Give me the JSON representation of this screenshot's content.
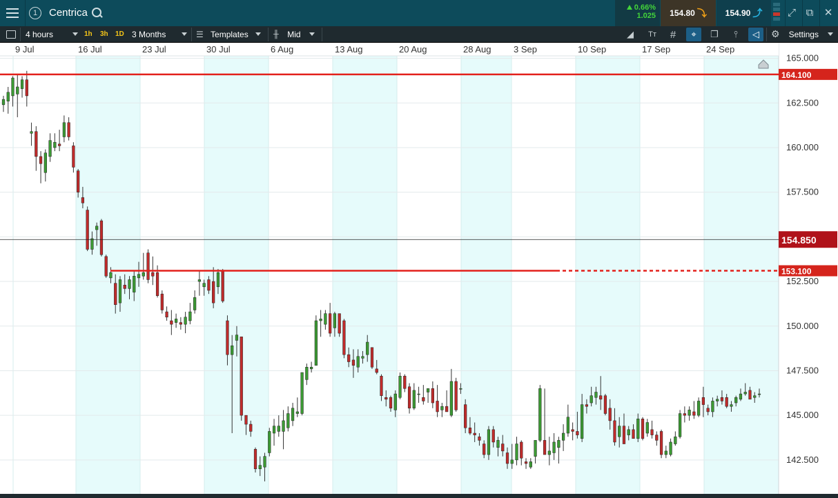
{
  "title_bar": {
    "instrument": "Centrica",
    "panel_number": "1",
    "change_percent": "0.66%",
    "change_abs": "1.025",
    "sell_price": "154.80",
    "buy_price": "154.90",
    "up_color": "#43d43a",
    "sell_color": "#f0a017",
    "buy_color": "#28b6e4"
  },
  "toolbar": {
    "interval": "4 hours",
    "quick_intervals": [
      "1h",
      "3h",
      "1D"
    ],
    "range": "3 Months",
    "templates_label": "Templates",
    "price_type": "Mid",
    "settings_label": "Settings",
    "icons": [
      "drawing-tools-icon",
      "text-tool-icon",
      "grid-icon",
      "crosshair-icon",
      "layers-icon",
      "indicators-icon",
      "price-tag-icon",
      "gear-icon"
    ]
  },
  "chart_data": {
    "type": "candlestick",
    "x_tick_labels": [
      "9 Jul",
      "16 Jul",
      "23 Jul",
      "30 Jul",
      "6 Aug",
      "13 Aug",
      "20 Aug",
      "28 Aug",
      "3 Sep",
      "10 Sep",
      "17 Sep",
      "24 Sep"
    ],
    "y_tick_labels": [
      "165.000",
      "162.500",
      "160.000",
      "157.500",
      "155.000",
      "152.500",
      "150.000",
      "147.500",
      "145.000",
      "142.500"
    ],
    "ylim": [
      140.6,
      165.1
    ],
    "current_price": "154.850",
    "horizontal_lines": [
      {
        "label": "164.100",
        "value": 164.1,
        "style": "solid"
      },
      {
        "label": "153.100",
        "value": 153.1,
        "style": "solid-then-dashed"
      }
    ],
    "colors": {
      "up": "#3c9a34",
      "down": "#c02b2b",
      "line": "#e3201b",
      "weekend_shade": "#e6fbfb"
    },
    "candles": [
      {
        "o": 162.4,
        "h": 162.9,
        "l": 162.0,
        "c": 162.7
      },
      {
        "o": 162.6,
        "h": 163.4,
        "l": 161.9,
        "c": 163.1
      },
      {
        "o": 162.9,
        "h": 164.0,
        "l": 162.3,
        "c": 163.9
      },
      {
        "o": 163.0,
        "h": 164.1,
        "l": 161.7,
        "c": 163.4
      },
      {
        "o": 163.3,
        "h": 164.0,
        "l": 162.8,
        "c": 163.8
      },
      {
        "o": 163.8,
        "h": 164.3,
        "l": 162.3,
        "c": 162.9
      },
      {
        "o": 160.8,
        "h": 161.4,
        "l": 160.1,
        "c": 160.9
      },
      {
        "o": 160.9,
        "h": 161.2,
        "l": 158.7,
        "c": 159.5
      },
      {
        "o": 159.5,
        "h": 159.8,
        "l": 158.0,
        "c": 159.1
      },
      {
        "o": 158.6,
        "h": 159.9,
        "l": 158.1,
        "c": 159.7
      },
      {
        "o": 159.5,
        "h": 160.8,
        "l": 159.2,
        "c": 160.4
      },
      {
        "o": 160.0,
        "h": 160.8,
        "l": 159.8,
        "c": 160.3
      },
      {
        "o": 160.2,
        "h": 161.0,
        "l": 159.8,
        "c": 160.1
      },
      {
        "o": 160.6,
        "h": 161.8,
        "l": 160.3,
        "c": 161.4
      },
      {
        "o": 161.4,
        "h": 161.7,
        "l": 160.4,
        "c": 160.6
      },
      {
        "o": 160.1,
        "h": 160.3,
        "l": 158.6,
        "c": 158.9
      },
      {
        "o": 158.7,
        "h": 158.8,
        "l": 157.2,
        "c": 157.5
      },
      {
        "o": 157.2,
        "h": 157.8,
        "l": 156.6,
        "c": 156.9
      },
      {
        "o": 156.5,
        "h": 156.7,
        "l": 154.2,
        "c": 154.3
      },
      {
        "o": 154.3,
        "h": 155.3,
        "l": 154.0,
        "c": 154.9
      },
      {
        "o": 155.4,
        "h": 155.8,
        "l": 154.5,
        "c": 155.6
      },
      {
        "o": 155.9,
        "h": 156.0,
        "l": 153.9,
        "c": 154.0
      },
      {
        "o": 153.9,
        "h": 154.0,
        "l": 152.7,
        "c": 152.8
      },
      {
        "o": 152.7,
        "h": 153.3,
        "l": 152.4,
        "c": 153.0
      },
      {
        "o": 152.4,
        "h": 152.9,
        "l": 150.7,
        "c": 151.2
      },
      {
        "o": 151.3,
        "h": 152.8,
        "l": 150.8,
        "c": 152.6
      },
      {
        "o": 152.3,
        "h": 152.9,
        "l": 151.8,
        "c": 152.1
      },
      {
        "o": 152.1,
        "h": 152.8,
        "l": 151.5,
        "c": 152.6
      },
      {
        "o": 151.9,
        "h": 153.1,
        "l": 151.4,
        "c": 152.8
      },
      {
        "o": 152.7,
        "h": 153.6,
        "l": 152.2,
        "c": 152.9
      },
      {
        "o": 152.8,
        "h": 154.1,
        "l": 152.6,
        "c": 153.0
      },
      {
        "o": 154.1,
        "h": 154.3,
        "l": 152.4,
        "c": 152.6
      },
      {
        "o": 153.0,
        "h": 153.9,
        "l": 152.3,
        "c": 152.8
      },
      {
        "o": 153.0,
        "h": 153.4,
        "l": 151.6,
        "c": 151.7
      },
      {
        "o": 151.8,
        "h": 152.0,
        "l": 150.7,
        "c": 150.9
      },
      {
        "o": 150.8,
        "h": 151.1,
        "l": 150.3,
        "c": 150.5
      },
      {
        "o": 150.3,
        "h": 150.9,
        "l": 149.5,
        "c": 150.1
      },
      {
        "o": 150.2,
        "h": 150.7,
        "l": 149.9,
        "c": 150.4
      },
      {
        "o": 150.2,
        "h": 150.5,
        "l": 149.8,
        "c": 150.1
      },
      {
        "o": 150.1,
        "h": 150.8,
        "l": 149.6,
        "c": 150.5
      },
      {
        "o": 150.3,
        "h": 151.3,
        "l": 150.1,
        "c": 150.8
      },
      {
        "o": 150.9,
        "h": 152.0,
        "l": 150.7,
        "c": 151.6
      },
      {
        "o": 152.5,
        "h": 153.1,
        "l": 151.7,
        "c": 152.6
      },
      {
        "o": 152.2,
        "h": 152.6,
        "l": 151.7,
        "c": 152.4
      },
      {
        "o": 152.6,
        "h": 152.8,
        "l": 151.8,
        "c": 152.0
      },
      {
        "o": 152.5,
        "h": 153.3,
        "l": 151.0,
        "c": 151.3
      },
      {
        "o": 152.2,
        "h": 153.2,
        "l": 151.8,
        "c": 153.0
      },
      {
        "o": 153.1,
        "h": 153.2,
        "l": 151.3,
        "c": 151.4
      },
      {
        "o": 150.3,
        "h": 150.6,
        "l": 147.8,
        "c": 148.4
      },
      {
        "o": 148.4,
        "h": 149.5,
        "l": 144.0,
        "c": 148.9
      },
      {
        "o": 149.2,
        "h": 150.0,
        "l": 148.3,
        "c": 149.5
      },
      {
        "o": 149.4,
        "h": 149.4,
        "l": 144.7,
        "c": 145.0
      },
      {
        "o": 145.0,
        "h": 145.0,
        "l": 143.9,
        "c": 144.5
      },
      {
        "o": 144.5,
        "h": 144.7,
        "l": 143.8,
        "c": 144.1
      },
      {
        "o": 143.1,
        "h": 143.2,
        "l": 141.8,
        "c": 142.0
      },
      {
        "o": 142.0,
        "h": 142.7,
        "l": 141.6,
        "c": 142.2
      },
      {
        "o": 142.1,
        "h": 142.9,
        "l": 141.3,
        "c": 142.7
      },
      {
        "o": 142.9,
        "h": 144.3,
        "l": 142.7,
        "c": 144.1
      },
      {
        "o": 144.0,
        "h": 144.8,
        "l": 143.3,
        "c": 144.4
      },
      {
        "o": 144.1,
        "h": 145.0,
        "l": 143.8,
        "c": 144.4
      },
      {
        "o": 144.1,
        "h": 145.3,
        "l": 143.1,
        "c": 144.7
      },
      {
        "o": 144.3,
        "h": 145.5,
        "l": 144.1,
        "c": 145.1
      },
      {
        "o": 144.7,
        "h": 145.7,
        "l": 144.4,
        "c": 145.4
      },
      {
        "o": 145.1,
        "h": 146.0,
        "l": 144.9,
        "c": 145.2
      },
      {
        "o": 145.1,
        "h": 147.4,
        "l": 145.0,
        "c": 147.4
      },
      {
        "o": 147.0,
        "h": 147.9,
        "l": 146.7,
        "c": 147.7
      },
      {
        "o": 147.6,
        "h": 148.0,
        "l": 147.4,
        "c": 147.7
      },
      {
        "o": 147.8,
        "h": 150.6,
        "l": 147.8,
        "c": 150.3
      },
      {
        "o": 150.3,
        "h": 150.9,
        "l": 149.4,
        "c": 150.4
      },
      {
        "o": 150.1,
        "h": 150.9,
        "l": 149.8,
        "c": 150.7
      },
      {
        "o": 150.7,
        "h": 151.3,
        "l": 149.4,
        "c": 149.6
      },
      {
        "o": 149.9,
        "h": 150.8,
        "l": 149.4,
        "c": 150.7
      },
      {
        "o": 150.7,
        "h": 150.7,
        "l": 149.4,
        "c": 149.6
      },
      {
        "o": 150.3,
        "h": 150.4,
        "l": 148.2,
        "c": 148.4
      },
      {
        "o": 148.4,
        "h": 148.8,
        "l": 147.7,
        "c": 148.0
      },
      {
        "o": 148.1,
        "h": 148.7,
        "l": 147.1,
        "c": 147.8
      },
      {
        "o": 147.7,
        "h": 148.7,
        "l": 147.4,
        "c": 148.3
      },
      {
        "o": 148.2,
        "h": 148.6,
        "l": 147.9,
        "c": 148.3
      },
      {
        "o": 148.4,
        "h": 149.5,
        "l": 148.0,
        "c": 149.1
      },
      {
        "o": 148.8,
        "h": 148.8,
        "l": 147.6,
        "c": 147.7
      },
      {
        "o": 147.6,
        "h": 148.1,
        "l": 147.3,
        "c": 147.4
      },
      {
        "o": 147.2,
        "h": 147.3,
        "l": 145.8,
        "c": 146.1
      },
      {
        "o": 146.0,
        "h": 146.4,
        "l": 145.5,
        "c": 145.9
      },
      {
        "o": 146.0,
        "h": 146.1,
        "l": 145.2,
        "c": 145.4
      },
      {
        "o": 145.3,
        "h": 146.4,
        "l": 144.9,
        "c": 146.2
      },
      {
        "o": 146.0,
        "h": 147.4,
        "l": 145.9,
        "c": 147.2
      },
      {
        "o": 147.2,
        "h": 147.3,
        "l": 146.3,
        "c": 146.5
      },
      {
        "o": 146.6,
        "h": 146.8,
        "l": 145.1,
        "c": 145.4
      },
      {
        "o": 145.4,
        "h": 146.8,
        "l": 145.3,
        "c": 146.4
      },
      {
        "o": 146.2,
        "h": 146.6,
        "l": 145.7,
        "c": 146.2
      },
      {
        "o": 146.0,
        "h": 146.7,
        "l": 145.6,
        "c": 145.8
      },
      {
        "o": 146.3,
        "h": 146.5,
        "l": 145.7,
        "c": 146.5
      },
      {
        "o": 146.5,
        "h": 146.9,
        "l": 145.4,
        "c": 145.7
      },
      {
        "o": 145.8,
        "h": 146.7,
        "l": 144.9,
        "c": 145.2
      },
      {
        "o": 145.3,
        "h": 145.7,
        "l": 144.9,
        "c": 145.5
      },
      {
        "o": 145.5,
        "h": 146.4,
        "l": 145.4,
        "c": 145.2
      },
      {
        "o": 145.0,
        "h": 147.6,
        "l": 144.9,
        "c": 146.9
      },
      {
        "o": 146.9,
        "h": 147.1,
        "l": 145.2,
        "c": 145.3
      },
      {
        "o": 146.5,
        "h": 146.8,
        "l": 146.2,
        "c": 146.5
      },
      {
        "o": 145.6,
        "h": 145.9,
        "l": 144.0,
        "c": 144.3
      },
      {
        "o": 144.3,
        "h": 144.9,
        "l": 143.9,
        "c": 144.0
      },
      {
        "o": 144.0,
        "h": 144.6,
        "l": 143.5,
        "c": 143.9
      },
      {
        "o": 143.8,
        "h": 144.0,
        "l": 143.3,
        "c": 143.6
      },
      {
        "o": 143.4,
        "h": 143.6,
        "l": 142.6,
        "c": 142.8
      },
      {
        "o": 142.8,
        "h": 144.4,
        "l": 142.5,
        "c": 144.2
      },
      {
        "o": 144.2,
        "h": 144.4,
        "l": 143.2,
        "c": 143.5
      },
      {
        "o": 143.2,
        "h": 143.8,
        "l": 142.7,
        "c": 143.6
      },
      {
        "o": 143.4,
        "h": 143.9,
        "l": 142.7,
        "c": 143.0
      },
      {
        "o": 142.9,
        "h": 143.2,
        "l": 142.0,
        "c": 142.3
      },
      {
        "o": 142.3,
        "h": 143.4,
        "l": 142.0,
        "c": 142.5
      },
      {
        "o": 142.5,
        "h": 143.8,
        "l": 142.2,
        "c": 143.4
      },
      {
        "o": 143.5,
        "h": 143.6,
        "l": 142.2,
        "c": 142.6
      },
      {
        "o": 142.4,
        "h": 142.6,
        "l": 142.0,
        "c": 142.3
      },
      {
        "o": 142.1,
        "h": 142.6,
        "l": 142.0,
        "c": 142.4
      },
      {
        "o": 142.7,
        "h": 143.6,
        "l": 142.3,
        "c": 143.6
      },
      {
        "o": 143.6,
        "h": 146.7,
        "l": 143.5,
        "c": 146.5
      },
      {
        "o": 143.6,
        "h": 146.5,
        "l": 143.0,
        "c": 142.8
      },
      {
        "o": 142.8,
        "h": 143.8,
        "l": 142.2,
        "c": 143.0
      },
      {
        "o": 142.9,
        "h": 144.0,
        "l": 142.5,
        "c": 143.5
      },
      {
        "o": 143.2,
        "h": 143.8,
        "l": 142.3,
        "c": 143.6
      },
      {
        "o": 143.6,
        "h": 144.5,
        "l": 143.0,
        "c": 144.0
      },
      {
        "o": 144.0,
        "h": 145.6,
        "l": 143.8,
        "c": 144.9
      },
      {
        "o": 144.2,
        "h": 144.6,
        "l": 143.6,
        "c": 144.1
      },
      {
        "o": 144.1,
        "h": 145.2,
        "l": 143.7,
        "c": 143.9
      },
      {
        "o": 143.7,
        "h": 146.2,
        "l": 143.5,
        "c": 145.6
      },
      {
        "o": 145.6,
        "h": 145.9,
        "l": 145.1,
        "c": 145.5
      },
      {
        "o": 145.7,
        "h": 146.6,
        "l": 145.5,
        "c": 146.1
      },
      {
        "o": 146.0,
        "h": 146.6,
        "l": 145.6,
        "c": 146.3
      },
      {
        "o": 146.1,
        "h": 147.2,
        "l": 145.3,
        "c": 145.9
      },
      {
        "o": 146.1,
        "h": 146.2,
        "l": 145.0,
        "c": 145.1
      },
      {
        "o": 145.4,
        "h": 145.9,
        "l": 144.2,
        "c": 144.7
      },
      {
        "o": 144.7,
        "h": 145.4,
        "l": 143.3,
        "c": 143.5
      },
      {
        "o": 143.8,
        "h": 144.9,
        "l": 143.2,
        "c": 144.4
      },
      {
        "o": 144.4,
        "h": 145.1,
        "l": 143.6,
        "c": 143.4
      },
      {
        "o": 143.9,
        "h": 144.4,
        "l": 143.6,
        "c": 144.2
      },
      {
        "o": 144.2,
        "h": 144.5,
        "l": 143.7,
        "c": 143.7
      },
      {
        "o": 143.7,
        "h": 145.1,
        "l": 143.5,
        "c": 144.8
      },
      {
        "o": 144.8,
        "h": 144.9,
        "l": 143.6,
        "c": 143.7
      },
      {
        "o": 144.0,
        "h": 144.8,
        "l": 143.8,
        "c": 144.6
      },
      {
        "o": 144.2,
        "h": 144.7,
        "l": 143.7,
        "c": 143.9
      },
      {
        "o": 143.9,
        "h": 144.1,
        "l": 143.3,
        "c": 143.6
      },
      {
        "o": 144.1,
        "h": 144.2,
        "l": 142.6,
        "c": 142.8
      },
      {
        "o": 142.8,
        "h": 143.3,
        "l": 142.6,
        "c": 143.0
      },
      {
        "o": 142.8,
        "h": 143.7,
        "l": 142.7,
        "c": 143.5
      },
      {
        "o": 143.4,
        "h": 144.1,
        "l": 143.3,
        "c": 143.8
      },
      {
        "o": 143.8,
        "h": 145.3,
        "l": 143.7,
        "c": 145.1
      },
      {
        "o": 145.1,
        "h": 145.5,
        "l": 144.6,
        "c": 145.0
      },
      {
        "o": 145.0,
        "h": 145.5,
        "l": 144.7,
        "c": 145.3
      },
      {
        "o": 145.2,
        "h": 145.8,
        "l": 144.8,
        "c": 145.0
      },
      {
        "o": 145.0,
        "h": 146.0,
        "l": 144.9,
        "c": 145.8
      },
      {
        "o": 146.0,
        "h": 146.6,
        "l": 144.9,
        "c": 145.6
      },
      {
        "o": 145.4,
        "h": 145.6,
        "l": 145.0,
        "c": 145.2
      },
      {
        "o": 145.2,
        "h": 146.0,
        "l": 144.9,
        "c": 145.8
      },
      {
        "o": 145.8,
        "h": 146.1,
        "l": 145.5,
        "c": 145.9
      },
      {
        "o": 146.0,
        "h": 146.4,
        "l": 145.6,
        "c": 145.8
      },
      {
        "o": 146.0,
        "h": 146.2,
        "l": 145.4,
        "c": 145.5
      },
      {
        "o": 145.5,
        "h": 145.8,
        "l": 145.2,
        "c": 145.6
      },
      {
        "o": 145.7,
        "h": 146.1,
        "l": 145.5,
        "c": 146.0
      },
      {
        "o": 145.9,
        "h": 146.5,
        "l": 145.8,
        "c": 146.2
      },
      {
        "o": 146.2,
        "h": 146.8,
        "l": 146.1,
        "c": 146.3
      },
      {
        "o": 146.4,
        "h": 146.6,
        "l": 145.9,
        "c": 145.9
      },
      {
        "o": 146.0,
        "h": 146.3,
        "l": 145.7,
        "c": 146.1
      },
      {
        "o": 146.2,
        "h": 146.5,
        "l": 146.0,
        "c": 146.2
      }
    ]
  },
  "price_axis_labels": {
    "high_line": "164.100",
    "current": "154.850",
    "mid_line": "153.100"
  }
}
